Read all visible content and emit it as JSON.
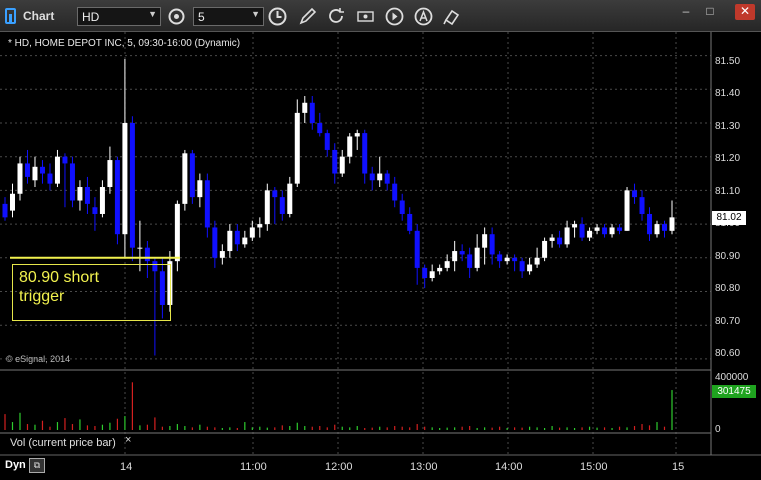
{
  "window": {
    "title": "Chart",
    "minimize": "–",
    "maximize": "□",
    "close": "✕"
  },
  "toolbar": {
    "symbol_value": "HD",
    "interval_value": "5",
    "icons": [
      "link-settings-icon",
      "clock-icon",
      "pencil-icon",
      "refresh-icon",
      "eye-icon",
      "play-icon",
      "text-tool-icon",
      "cursor-tool-icon"
    ]
  },
  "chart": {
    "header": "* HD, HOME DEPOT INC, 5, 09:30-16:00 (Dynamic)",
    "copyright": "© eSignal, 2014",
    "annotation": {
      "line1": "80.90 short",
      "line2": "trigger",
      "level": 80.9,
      "color": "#f2f24f"
    },
    "last_price": "81.02",
    "colors": {
      "up": "#ffffff",
      "down": "#1010ff",
      "grid": "#4a4a4a"
    }
  },
  "price_axis": [
    "81.50",
    "81.40",
    "81.30",
    "81.20",
    "81.10",
    "81.00",
    "80.90",
    "80.80",
    "80.70",
    "80.60"
  ],
  "volume_pane": {
    "caption": "Vol (current price bar)",
    "close_glyph": "×",
    "axis_top": "400000",
    "axis_zero": "0",
    "current_value": "301475"
  },
  "time_axis": [
    "14",
    "11:00",
    "12:00",
    "13:00",
    "14:00",
    "15:00",
    "15"
  ],
  "footer": {
    "mode": "Dyn"
  },
  "chart_data": {
    "type": "candlestick",
    "ylim": [
      80.57,
      81.57
    ],
    "y_ticks": [
      81.5,
      81.4,
      81.3,
      81.2,
      81.1,
      81.0,
      80.9,
      80.8,
      80.7,
      80.6
    ],
    "volume_ylim": [
      0,
      400000
    ],
    "candles": [
      [
        81.06,
        81.02,
        81.08,
        81.01
      ],
      [
        81.04,
        81.09,
        81.12,
        81.02
      ],
      [
        81.09,
        81.18,
        81.2,
        81.07
      ],
      [
        81.18,
        81.14,
        81.22,
        81.12
      ],
      [
        81.13,
        81.17,
        81.2,
        81.11
      ],
      [
        81.17,
        81.15,
        81.19,
        81.12
      ],
      [
        81.15,
        81.12,
        81.18,
        81.1
      ],
      [
        81.12,
        81.2,
        81.22,
        81.11
      ],
      [
        81.2,
        81.18,
        81.21,
        81.05
      ],
      [
        81.18,
        81.07,
        81.2,
        81.05
      ],
      [
        81.07,
        81.11,
        81.13,
        81.04
      ],
      [
        81.11,
        81.06,
        81.14,
        81.03
      ],
      [
        81.05,
        81.03,
        81.08,
        80.98
      ],
      [
        81.03,
        81.11,
        81.13,
        81.02
      ],
      [
        81.11,
        81.19,
        81.23,
        81.09
      ],
      [
        81.19,
        80.97,
        81.2,
        80.94
      ],
      [
        80.97,
        81.3,
        81.49,
        80.9
      ],
      [
        81.3,
        80.93,
        81.32,
        80.89
      ],
      [
        80.93,
        80.93,
        81.01,
        80.86
      ],
      [
        80.93,
        80.89,
        80.95,
        80.84
      ],
      [
        80.89,
        80.86,
        80.9,
        80.61
      ],
      [
        80.86,
        80.76,
        80.9,
        80.72
      ],
      [
        80.76,
        80.89,
        80.92,
        80.74
      ],
      [
        80.89,
        81.06,
        81.07,
        80.86
      ],
      [
        81.06,
        81.21,
        81.22,
        81.04
      ],
      [
        81.21,
        81.08,
        81.22,
        81.06
      ],
      [
        81.08,
        81.13,
        81.15,
        81.05
      ],
      [
        81.13,
        80.99,
        81.15,
        80.96
      ],
      [
        80.99,
        80.9,
        81.01,
        80.87
      ],
      [
        80.9,
        80.92,
        80.94,
        80.88
      ],
      [
        80.92,
        80.98,
        81.0,
        80.9
      ],
      [
        80.98,
        80.94,
        81.0,
        80.92
      ],
      [
        80.94,
        80.96,
        80.98,
        80.93
      ],
      [
        80.96,
        80.99,
        81.01,
        80.95
      ],
      [
        80.99,
        81.0,
        81.02,
        80.96
      ],
      [
        81.0,
        81.1,
        81.12,
        80.98
      ],
      [
        81.1,
        81.08,
        81.11,
        81.0
      ],
      [
        81.08,
        81.03,
        81.1,
        81.01
      ],
      [
        81.03,
        81.12,
        81.14,
        81.02
      ],
      [
        81.12,
        81.33,
        81.37,
        81.11
      ],
      [
        81.33,
        81.36,
        81.38,
        81.3
      ],
      [
        81.36,
        81.3,
        81.38,
        81.28
      ],
      [
        81.3,
        81.27,
        81.33,
        81.26
      ],
      [
        81.27,
        81.22,
        81.28,
        81.2
      ],
      [
        81.22,
        81.15,
        81.24,
        81.12
      ],
      [
        81.15,
        81.2,
        81.22,
        81.14
      ],
      [
        81.2,
        81.26,
        81.27,
        81.18
      ],
      [
        81.26,
        81.27,
        81.28,
        81.22
      ],
      [
        81.27,
        81.15,
        81.28,
        81.12
      ],
      [
        81.15,
        81.13,
        81.17,
        81.1
      ],
      [
        81.13,
        81.15,
        81.2,
        81.11
      ],
      [
        81.15,
        81.12,
        81.16,
        81.1
      ],
      [
        81.12,
        81.07,
        81.14,
        81.05
      ],
      [
        81.07,
        81.03,
        81.09,
        81.01
      ],
      [
        81.03,
        80.98,
        81.05,
        80.97
      ],
      [
        80.98,
        80.87,
        81.0,
        80.82
      ],
      [
        80.87,
        80.84,
        80.88,
        80.81
      ],
      [
        80.84,
        80.86,
        80.88,
        80.83
      ],
      [
        80.86,
        80.87,
        80.88,
        80.85
      ],
      [
        80.87,
        80.89,
        80.91,
        80.86
      ],
      [
        80.89,
        80.92,
        80.95,
        80.86
      ],
      [
        80.92,
        80.91,
        80.94,
        80.89
      ],
      [
        80.91,
        80.87,
        80.93,
        80.84
      ],
      [
        80.87,
        80.93,
        80.97,
        80.86
      ],
      [
        80.93,
        80.97,
        80.99,
        80.88
      ],
      [
        80.97,
        80.91,
        80.99,
        80.88
      ],
      [
        80.91,
        80.89,
        80.92,
        80.87
      ],
      [
        80.89,
        80.9,
        80.91,
        80.88
      ],
      [
        80.9,
        80.89,
        80.91,
        80.86
      ],
      [
        80.89,
        80.86,
        80.9,
        80.84
      ],
      [
        80.86,
        80.88,
        80.9,
        80.85
      ],
      [
        80.88,
        80.9,
        80.93,
        80.87
      ],
      [
        80.9,
        80.95,
        80.96,
        80.89
      ],
      [
        80.95,
        80.96,
        80.97,
        80.93
      ],
      [
        80.96,
        80.94,
        80.98,
        80.93
      ],
      [
        80.94,
        80.99,
        81.01,
        80.93
      ],
      [
        80.99,
        81.0,
        81.01,
        80.96
      ],
      [
        81.0,
        80.96,
        81.02,
        80.95
      ],
      [
        80.96,
        80.98,
        80.99,
        80.95
      ],
      [
        80.98,
        80.99,
        81.0,
        80.97
      ],
      [
        80.99,
        80.97,
        81.0,
        80.96
      ],
      [
        80.97,
        80.99,
        81.0,
        80.96
      ],
      [
        80.99,
        80.98,
        81.0,
        80.97
      ],
      [
        80.98,
        81.1,
        81.11,
        80.98
      ],
      [
        81.1,
        81.08,
        81.12,
        81.06
      ],
      [
        81.08,
        81.03,
        81.1,
        81.01
      ],
      [
        81.03,
        80.97,
        81.05,
        80.95
      ],
      [
        80.97,
        81.0,
        81.01,
        80.96
      ],
      [
        81.0,
        80.98,
        81.01,
        80.96
      ],
      [
        80.98,
        81.02,
        81.07,
        80.97
      ]
    ],
    "volume": [
      120000,
      60000,
      130000,
      45000,
      40000,
      70000,
      25000,
      60000,
      90000,
      45000,
      80000,
      35000,
      30000,
      40000,
      55000,
      85000,
      105000,
      360000,
      35000,
      40000,
      95000,
      25000,
      30000,
      45000,
      30000,
      20000,
      40000,
      25000,
      20000,
      15000,
      20000,
      15000,
      60000,
      20000,
      25000,
      18000,
      20000,
      35000,
      30000,
      55000,
      30000,
      25000,
      30000,
      20000,
      40000,
      25000,
      20000,
      30000,
      15000,
      18000,
      25000,
      20000,
      30000,
      25000,
      20000,
      45000,
      25000,
      20000,
      15000,
      18000,
      20000,
      25000,
      30000,
      15000,
      20000,
      18000,
      25000,
      15000,
      20000,
      18000,
      25000,
      20000,
      15000,
      30000,
      18000,
      20000,
      15000,
      20000,
      25000,
      18000,
      20000,
      15000,
      25000,
      20000,
      30000,
      45000,
      35000,
      60000,
      25000,
      301475
    ]
  }
}
